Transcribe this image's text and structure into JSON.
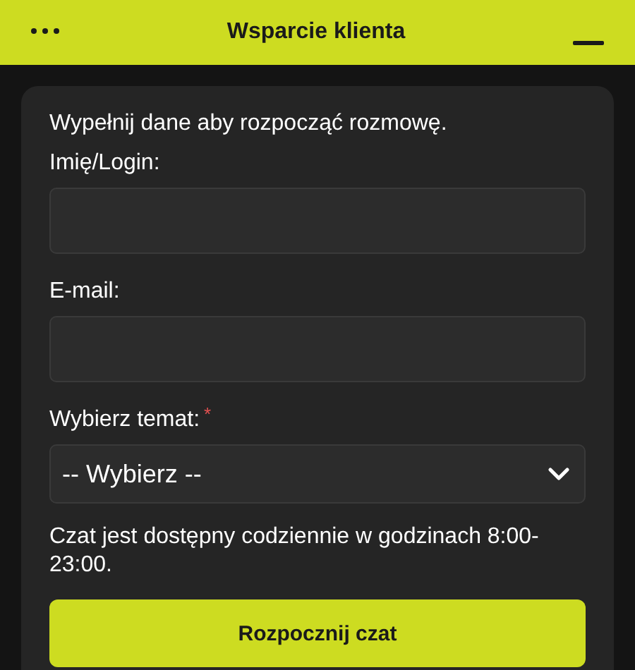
{
  "header": {
    "title": "Wsparcie klienta"
  },
  "form": {
    "intro": "Wypełnij dane aby rozpocząć rozmowę.",
    "fields": [
      {
        "kind": "text",
        "label": "Imię/Login:"
      },
      {
        "kind": "text",
        "label": "E-mail:"
      },
      {
        "kind": "select",
        "label": "Wybierz temat:",
        "required_mark": "*",
        "value": "-- Wybierz --"
      }
    ],
    "notice": "Czat jest dostępny codziennie w godzinach 8:00-23:00.",
    "submit": "Rozpocznij czat"
  }
}
